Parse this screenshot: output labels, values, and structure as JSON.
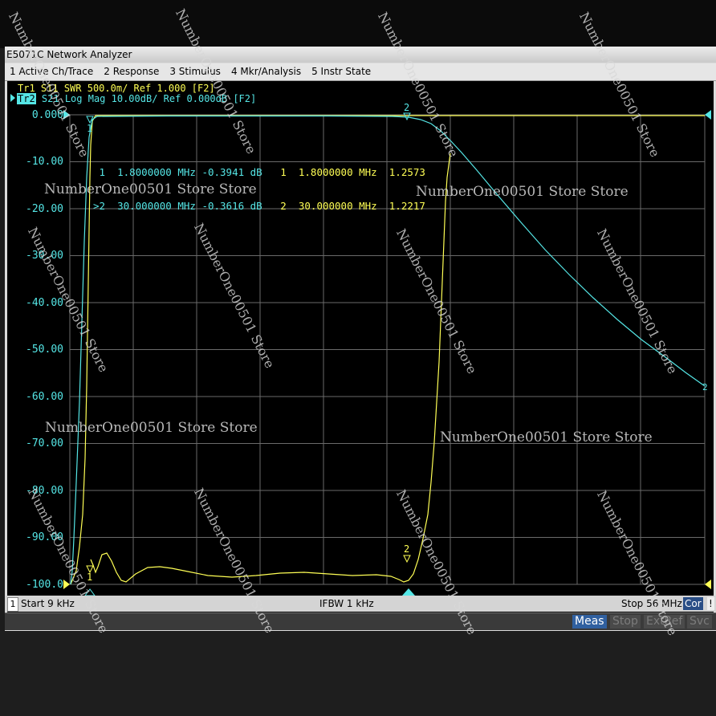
{
  "window": {
    "title": "E5071C Network Analyzer"
  },
  "menu": [
    {
      "label": "1 Active Ch/Trace"
    },
    {
      "label": "2 Response"
    },
    {
      "label": "3 Stimulus"
    },
    {
      "label": "4 Mkr/Analysis"
    },
    {
      "label": "5 Instr State"
    }
  ],
  "traces": [
    {
      "id": "Tr1",
      "text": "S11 SWR 500.0m/ Ref 1.000 [F2]",
      "color": "#ffff55",
      "active": false
    },
    {
      "id": "Tr2",
      "text": "S21 Log Mag 10.00dB/ Ref 0.000dB [F2]",
      "color": "#55e6e6",
      "active": true
    }
  ],
  "y_tick_labels": [
    "0.000",
    "-10.00",
    "-20.00",
    "-30.00",
    "-40.00",
    "-50.00",
    "-60.00",
    "-70.00",
    "-80.00",
    "-90.00",
    "-100.0"
  ],
  "markers": {
    "tr2": [
      {
        "num": "1",
        "prefix": "1",
        "freq": "1.8000000 MHz",
        "value": "-0.3941 dB"
      },
      {
        "num": "2",
        "prefix": ">2",
        "freq": "30.000000 MHz",
        "value": "-0.3616 dB"
      }
    ],
    "tr1": [
      {
        "num": "1",
        "freq": "1.8000000 MHz",
        "value": "1.2573"
      },
      {
        "num": "2",
        "freq": "30.000000 MHz",
        "value": "1.2217"
      }
    ],
    "trace_end_label": "2"
  },
  "status": {
    "channel": "1",
    "start": "Start 9 kHz",
    "ifbw": "IFBW 1 kHz",
    "stop": "Stop 56 MHz",
    "cor": "Cor",
    "excl": "!"
  },
  "softkeys": [
    {
      "label": "Meas",
      "active": true
    },
    {
      "label": "Stop",
      "active": false
    },
    {
      "label": "ExtRef",
      "active": false
    },
    {
      "label": "Svc",
      "active": false
    }
  ],
  "watermark": "NumberOne00501 Store Store",
  "watermark_short": "NumberOne00501 Store",
  "colors": {
    "trace1": "#ffff55",
    "trace2": "#55e6e6",
    "grid": "#6a6a6a",
    "softkey_active_bg": "#3060a0"
  }
}
